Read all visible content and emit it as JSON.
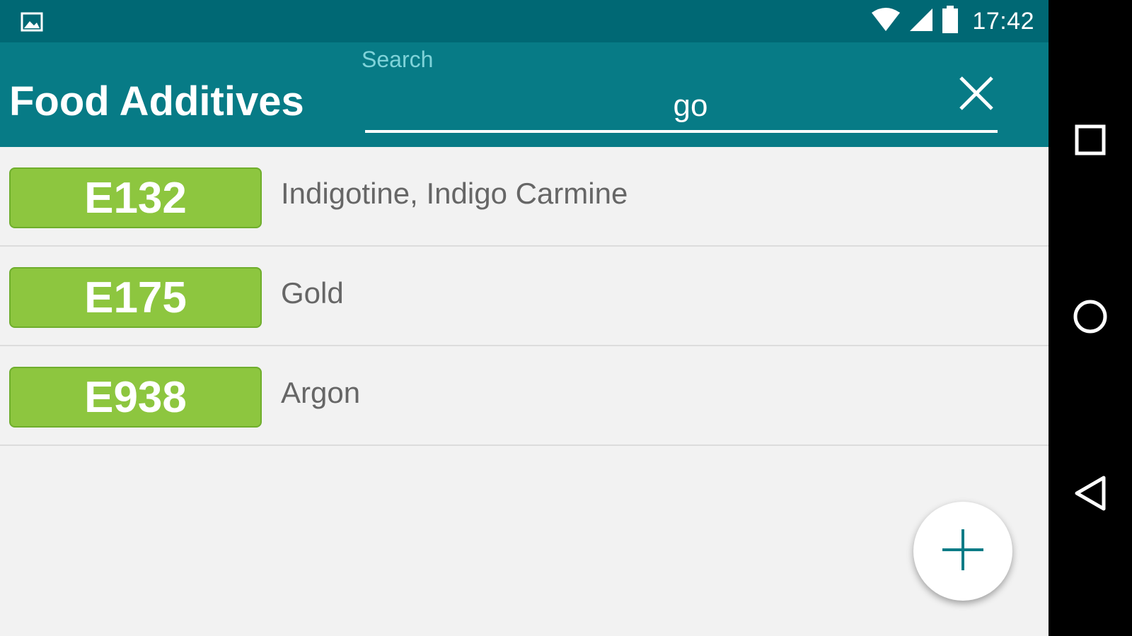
{
  "status_bar": {
    "time": "17:42",
    "icons": [
      "gallery-icon",
      "wifi-icon",
      "signal-icon",
      "battery-icon"
    ]
  },
  "app_bar": {
    "title": "Food Additives",
    "search": {
      "label": "Search",
      "value": "go"
    },
    "clear_icon": "close-icon"
  },
  "results": [
    {
      "code": "E132",
      "name": "Indigotine, Indigo Carmine"
    },
    {
      "code": "E175",
      "name": "Gold"
    },
    {
      "code": "E938",
      "name": "Argon"
    }
  ],
  "fab": {
    "icon": "plus-icon"
  },
  "nav_bar": {
    "buttons": [
      "recents-icon",
      "home-icon",
      "back-icon"
    ]
  },
  "colors": {
    "status_bar": "#006874",
    "app_bar": "#077b86",
    "badge": "#8dc63f",
    "accent": "#077b86",
    "background": "#f2f2f2"
  }
}
